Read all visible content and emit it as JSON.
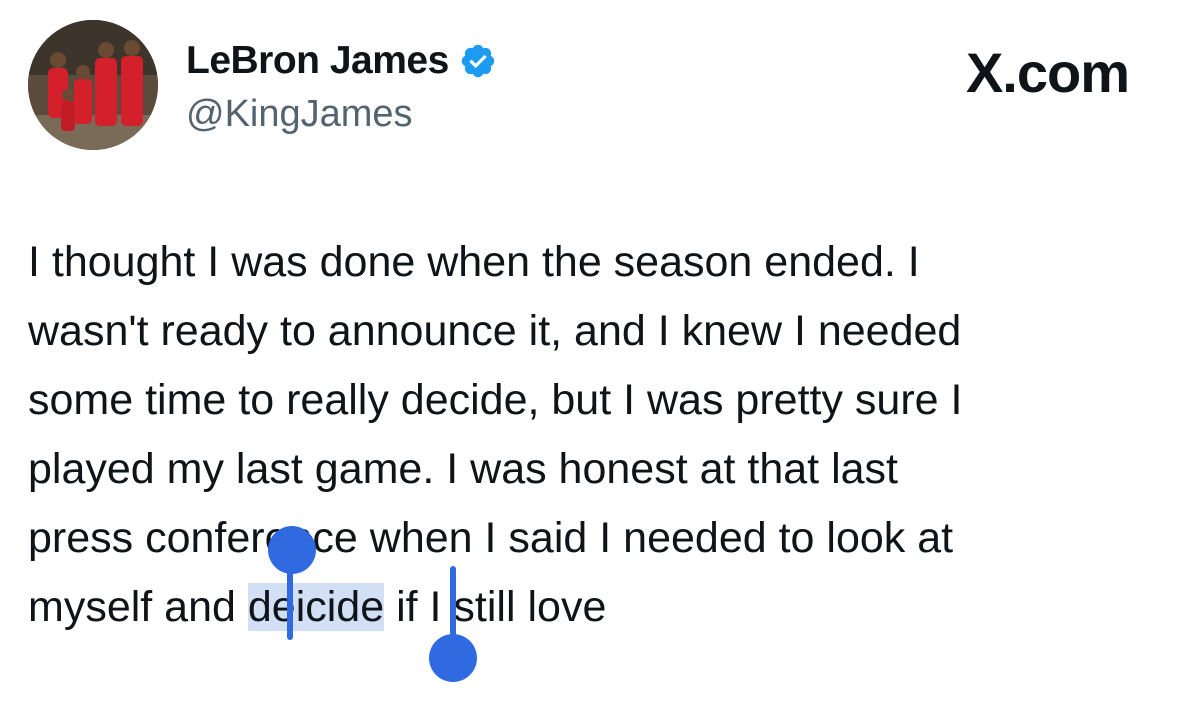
{
  "author": {
    "display_name": "LeBron James",
    "handle": "@KingJames",
    "verified": true,
    "avatar": "profile-photo"
  },
  "brand": {
    "label": "X.com"
  },
  "tweet": {
    "line1": "I thought I was done when the season ended. I",
    "line2": "wasn't ready to announce it, and I knew I needed",
    "line3": "some time to really decide, but I was pretty sure I",
    "line4": "played my last game. I was honest at that last",
    "line5": "press conference when I said I needed to look at",
    "line6_before": "myself and ",
    "line6_selected": "deicide",
    "line6_after": " if I still love"
  },
  "colors": {
    "text": "#0f1419",
    "secondary_text": "#536471",
    "verified_badge": "#1d9bf0",
    "selection_handle": "#2f6ae0",
    "selection_highlight": "#5c8cdc"
  },
  "icons": {
    "verified": "verified-badge-icon",
    "selection_start": "selection-start-handle",
    "selection_end": "selection-end-handle"
  }
}
